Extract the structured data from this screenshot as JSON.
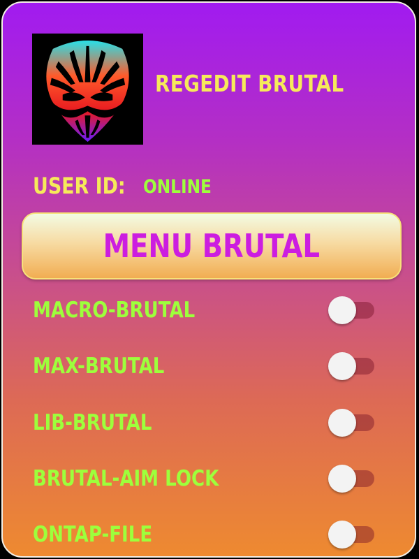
{
  "app": {
    "title": "REGEDIT BRUTAL",
    "logo_icon": "tribal-mask-icon"
  },
  "user": {
    "id_label": "USER ID:",
    "status": "ONLINE"
  },
  "menu_button": {
    "label": "MENU BRUTAL"
  },
  "toggles": [
    {
      "label": "MACRO-BRUTAL",
      "on": false
    },
    {
      "label": "MAX-BRUTAL",
      "on": false
    },
    {
      "label": "LIB-BRUTAL",
      "on": false
    },
    {
      "label": "BRUTAL-AIM LOCK",
      "on": false
    },
    {
      "label": "ONTAP-FILE",
      "on": false
    }
  ],
  "colors": {
    "gradient_top": "#a11bf0",
    "gradient_bottom": "#ee8a30",
    "title_yellow": "#f6ea5a",
    "label_green": "#9dff3c",
    "menu_text_magenta": "#cc1de0"
  }
}
